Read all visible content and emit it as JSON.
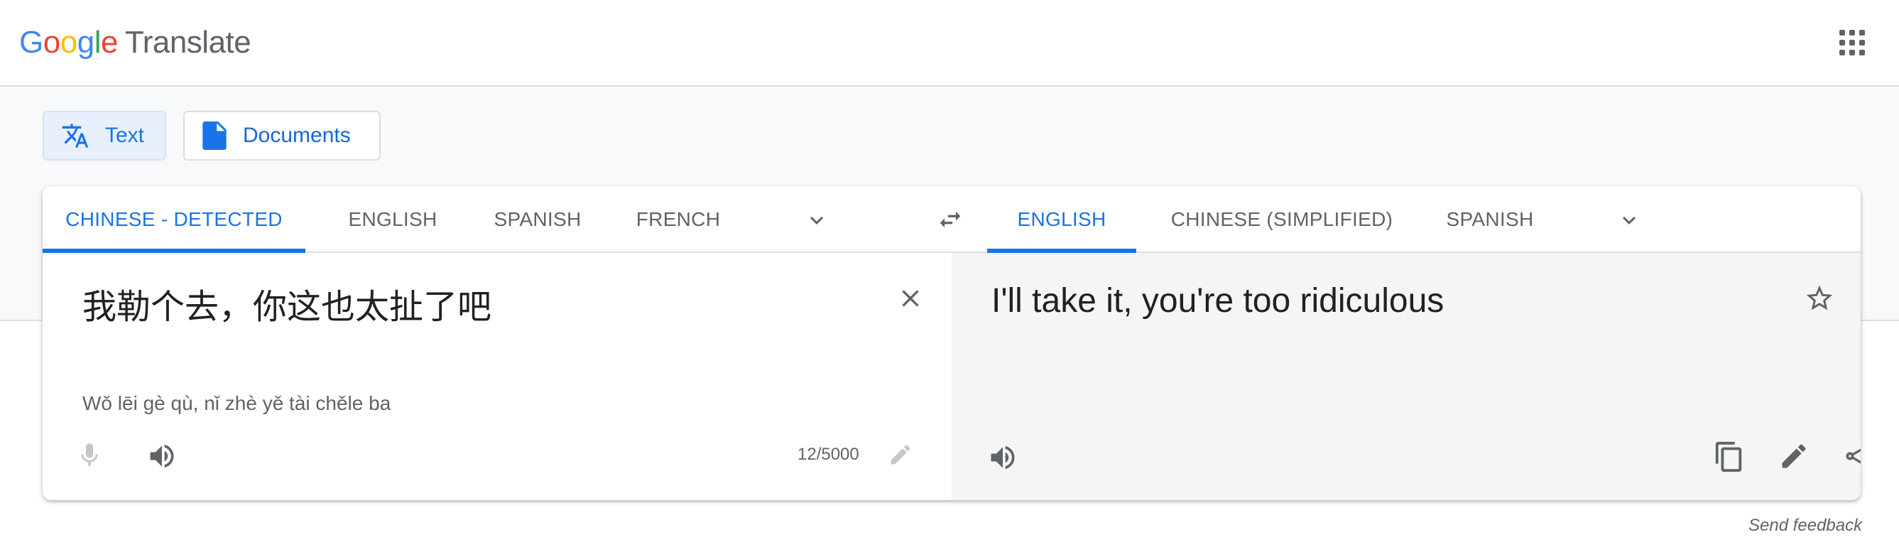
{
  "header": {
    "logo_google": [
      "G",
      "o",
      "o",
      "g",
      "l",
      "e"
    ],
    "product": "Translate"
  },
  "modes": {
    "text_label": "Text",
    "documents_label": "Documents"
  },
  "source_languages": {
    "tabs": [
      "CHINESE - DETECTED",
      "ENGLISH",
      "SPANISH",
      "FRENCH"
    ],
    "active_index": 0
  },
  "target_languages": {
    "tabs": [
      "ENGLISH",
      "CHINESE (SIMPLIFIED)",
      "SPANISH"
    ],
    "active_index": 0
  },
  "source": {
    "text": "我勒个去，你这也太扯了吧",
    "transliteration": "Wǒ lēi gè qù, nǐ zhè yě tài chěle ba",
    "char_count": "12/5000"
  },
  "target": {
    "text": "I'll take it, you're too ridiculous"
  },
  "footer": {
    "feedback": "Send feedback"
  },
  "colors": {
    "accent": "#1a73e8",
    "active_chip_bg": "#e8f0fe",
    "icon_gray": "#5f6368",
    "target_pane_bg": "#f5f5f5"
  },
  "icons": {
    "apps": "apps-grid-icon",
    "text_mode": "translate-icon",
    "docs_mode": "document-icon",
    "swap": "swap-languages-icon",
    "clear": "close-icon",
    "mic": "microphone-icon",
    "speaker": "speaker-icon",
    "edit": "pencil-icon",
    "star": "star-icon",
    "copy": "copy-icon",
    "share": "share-icon"
  }
}
